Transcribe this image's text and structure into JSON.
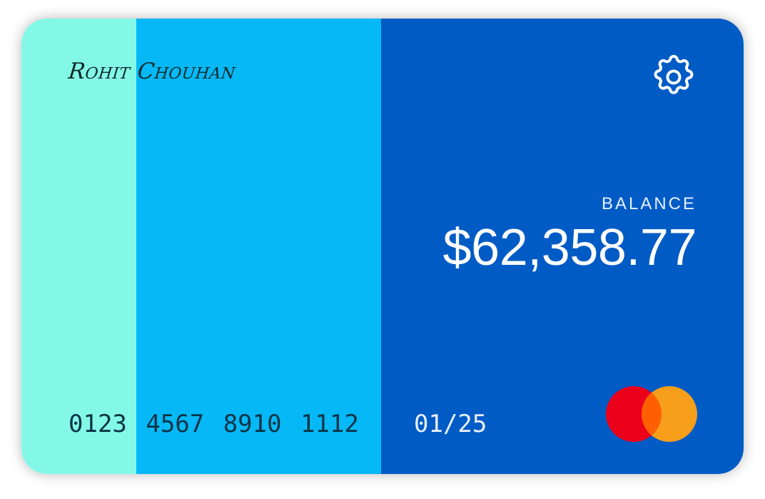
{
  "card": {
    "holder_name": "Rohit Chouhan",
    "balance_label": "BALANCE",
    "balance_value": "$62,358.77",
    "card_number": "0123 4567 8910 1112",
    "expiry": "01/25"
  },
  "icons": {
    "settings": "gear-icon",
    "brand": "mastercard-logo"
  },
  "colors": {
    "stripe_1": "#84f8e6",
    "stripe_2": "#06b8f5",
    "stripe_3": "#015bc5",
    "brand_red": "#eb001b",
    "brand_orange": "#f79e1b",
    "brand_overlap": "#ff5f00"
  }
}
